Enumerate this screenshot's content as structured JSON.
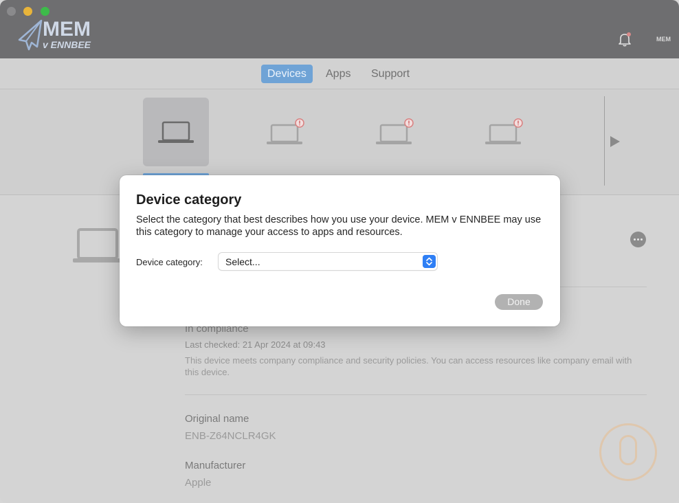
{
  "app": {
    "logo_main": "MEM",
    "logo_sub": "v ENNBEE",
    "mini_logo": "MEM"
  },
  "nav": {
    "tabs": [
      {
        "label": "Devices",
        "active": true
      },
      {
        "label": "Apps",
        "active": false
      },
      {
        "label": "Support",
        "active": false
      }
    ]
  },
  "device_strip": {
    "devices": [
      {
        "icon": "laptop-icon",
        "selected": true,
        "warning": false
      },
      {
        "icon": "laptop-icon",
        "selected": false,
        "warning": true
      },
      {
        "icon": "laptop-icon",
        "selected": false,
        "warning": true
      },
      {
        "icon": "laptop-icon",
        "selected": false,
        "warning": true
      }
    ]
  },
  "details": {
    "compliance_status": "In compliance",
    "last_checked": "Last checked: 21 Apr 2024 at 09:43",
    "compliance_description": "This device meets company compliance and security policies. You can access resources like company email with this device.",
    "original_name_label": "Original name",
    "original_name_value": "ENB-Z64NCLR4GK",
    "manufacturer_label": "Manufacturer",
    "manufacturer_value": "Apple"
  },
  "dialog": {
    "title": "Device category",
    "message": "Select the category that best describes how you use your device. MEM v ENNBEE may use this category to manage your access to apps and resources.",
    "field_label": "Device category:",
    "select_value": "Select...",
    "done_label": "Done"
  },
  "colors": {
    "accent": "#6fa3d6",
    "select_stepper": "#2f7ff5",
    "warning_badge": "#e05a5a",
    "close_dot": "#8a8a8c",
    "minimize_dot": "#e8b43a",
    "maximize_dot": "#3dbb4a"
  }
}
